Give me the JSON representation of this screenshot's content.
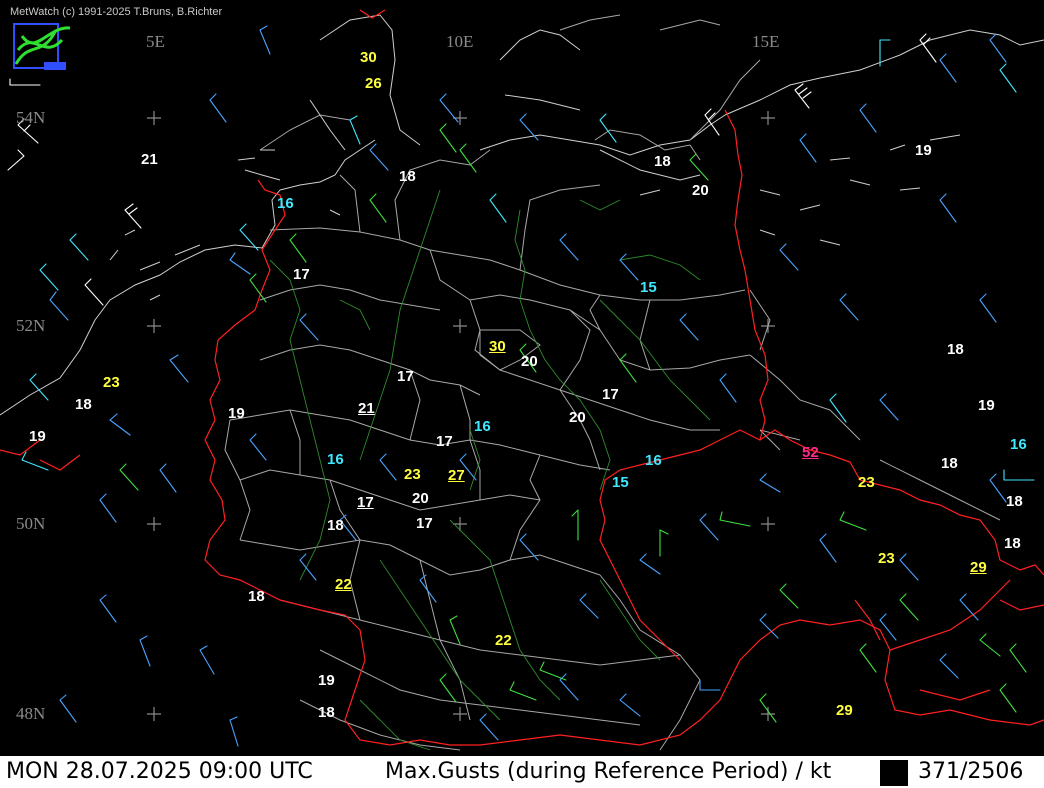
{
  "credit": "MetWatch  (c) 1991-2025 T.Bruns, B.Richter",
  "grid_labels": {
    "lon": [
      "5E",
      "10E",
      "15E"
    ],
    "lat": [
      "54N",
      "52N",
      "50N",
      "48N"
    ]
  },
  "colors": {
    "background": "#000000",
    "border": "#ff2020",
    "coastline": "#cfcfcf",
    "state_line": "#a8a8a8",
    "river": "#2e8b2e",
    "value_white": "#ffffff",
    "value_cyan": "#40e8ff",
    "value_yellow": "#ffff40",
    "value_magenta": "#ff2a8a"
  },
  "gusts": [
    {
      "v": "30",
      "c": "yellow"
    },
    {
      "v": "26",
      "c": "yellow"
    },
    {
      "v": "21",
      "c": "white"
    },
    {
      "v": "18",
      "c": "white"
    },
    {
      "v": "18",
      "c": "white"
    },
    {
      "v": "20",
      "c": "white"
    },
    {
      "v": "19",
      "c": "white"
    },
    {
      "v": "16",
      "c": "cyan"
    },
    {
      "v": "17",
      "c": "white"
    },
    {
      "v": "15",
      "c": "cyan"
    },
    {
      "v": "30",
      "c": "yellow",
      "u": true
    },
    {
      "v": "20",
      "c": "white"
    },
    {
      "v": "18",
      "c": "white"
    },
    {
      "v": "23",
      "c": "yellow"
    },
    {
      "v": "18",
      "c": "white"
    },
    {
      "v": "17",
      "c": "white"
    },
    {
      "v": "19",
      "c": "white"
    },
    {
      "v": "21",
      "c": "white",
      "u": true
    },
    {
      "v": "17",
      "c": "white"
    },
    {
      "v": "20",
      "c": "white"
    },
    {
      "v": "19",
      "c": "white"
    },
    {
      "v": "19",
      "c": "white"
    },
    {
      "v": "17",
      "c": "white"
    },
    {
      "v": "16",
      "c": "cyan"
    },
    {
      "v": "16",
      "c": "cyan"
    },
    {
      "v": "16",
      "c": "cyan"
    },
    {
      "v": "52",
      "c": "magenta",
      "u": true
    },
    {
      "v": "16",
      "c": "cyan"
    },
    {
      "v": "23",
      "c": "yellow"
    },
    {
      "v": "27",
      "c": "yellow",
      "u": true
    },
    {
      "v": "15",
      "c": "cyan"
    },
    {
      "v": "18",
      "c": "white"
    },
    {
      "v": "23",
      "c": "yellow"
    },
    {
      "v": "20",
      "c": "white"
    },
    {
      "v": "17",
      "c": "white",
      "u": true
    },
    {
      "v": "18",
      "c": "white"
    },
    {
      "v": "17",
      "c": "white"
    },
    {
      "v": "18",
      "c": "white"
    },
    {
      "v": "23",
      "c": "yellow"
    },
    {
      "v": "29",
      "c": "yellow",
      "u": true
    },
    {
      "v": "22",
      "c": "yellow",
      "u": true
    },
    {
      "v": "18",
      "c": "white"
    },
    {
      "v": "22",
      "c": "yellow"
    },
    {
      "v": "19",
      "c": "white"
    },
    {
      "v": "18",
      "c": "white"
    },
    {
      "v": "29",
      "c": "yellow"
    },
    {
      "v": "18",
      "c": "white"
    }
  ],
  "status": {
    "datetime": "MON 28.07.2025 09:00 UTC",
    "title": "Max.Gusts (during Reference Period) / kt",
    "counter": "371/2506"
  }
}
